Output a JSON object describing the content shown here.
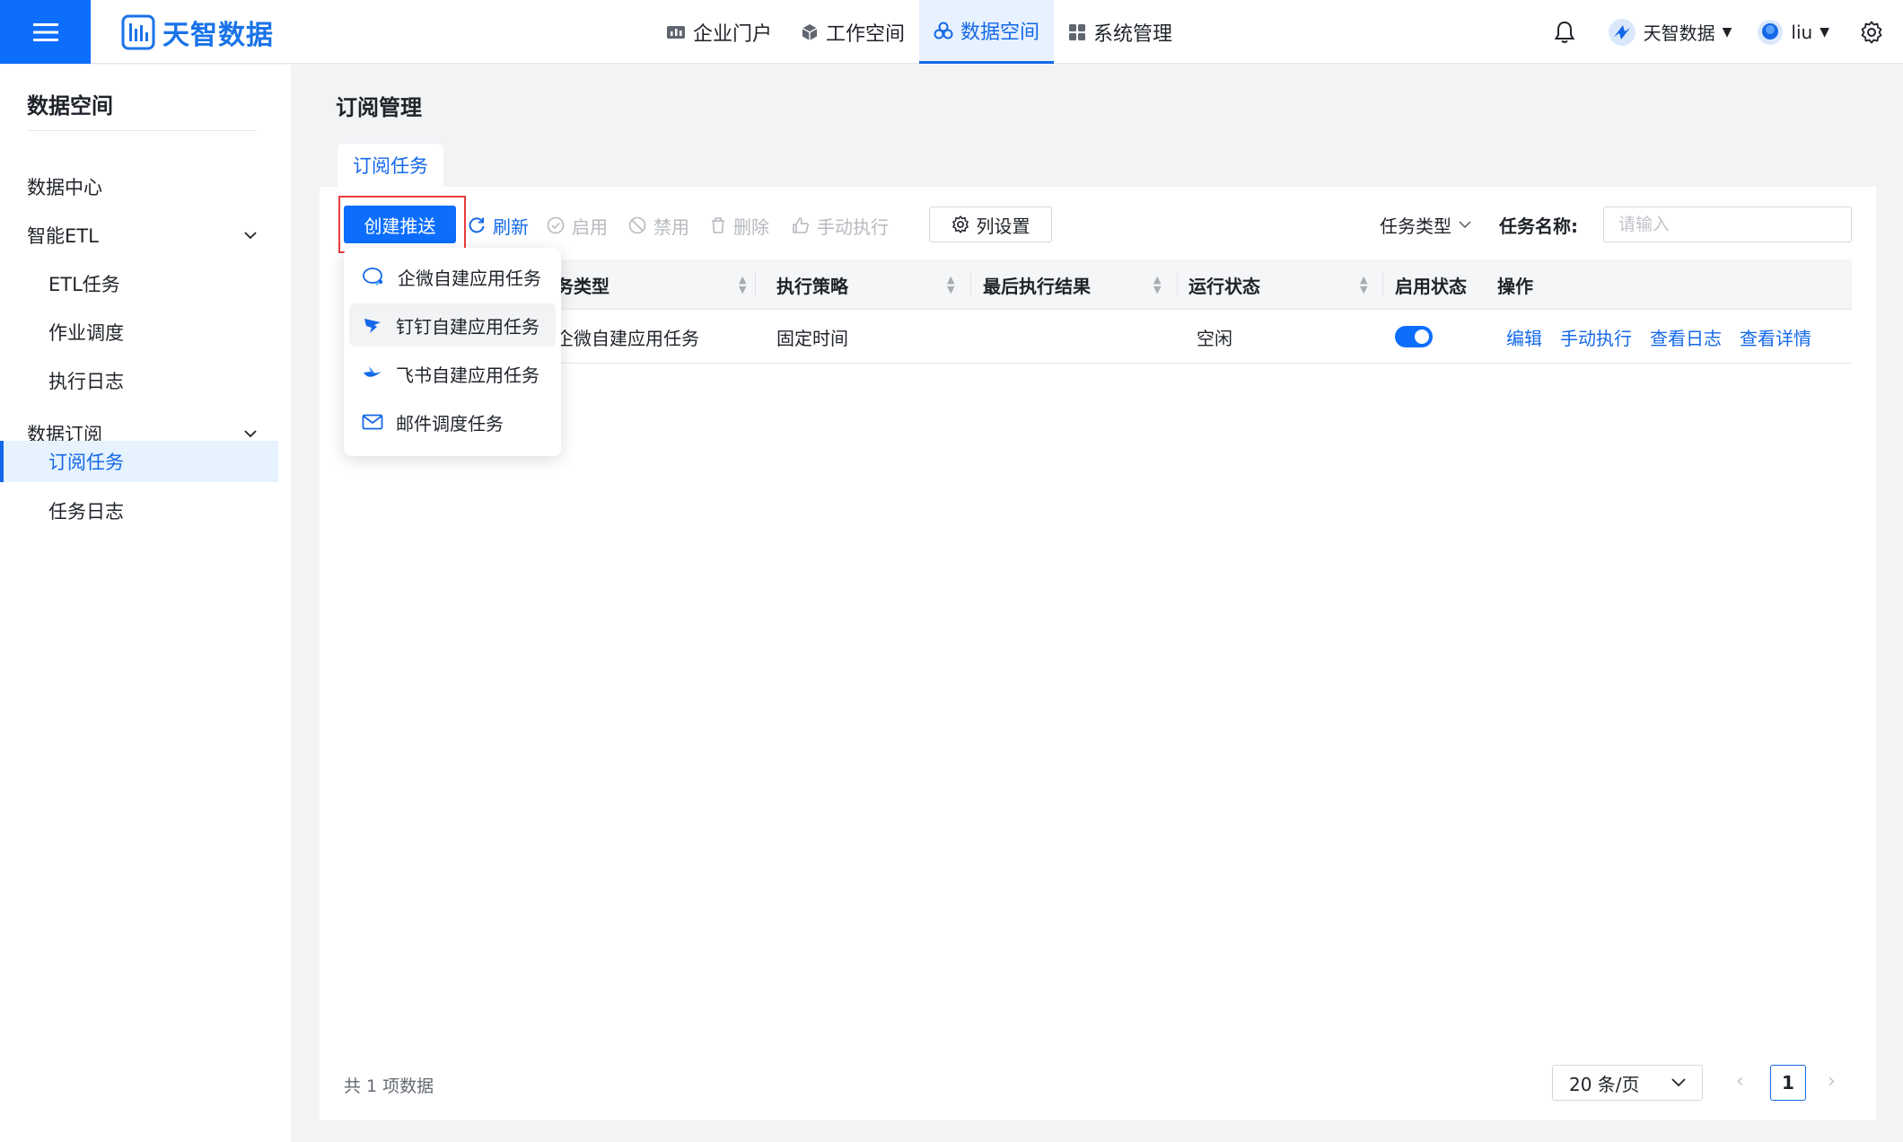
{
  "header": {
    "logo_text": "天智数据",
    "nav": [
      {
        "label": "企业门户",
        "icon": "chart-icon"
      },
      {
        "label": "工作空间",
        "icon": "cube-icon"
      },
      {
        "label": "数据空间",
        "icon": "cluster-icon",
        "active": true
      },
      {
        "label": "系统管理",
        "icon": "grid-icon"
      }
    ],
    "org_label": "天智数据",
    "user_label": "liu"
  },
  "sidebar": {
    "title": "数据空间",
    "items": [
      {
        "label": "数据中心"
      },
      {
        "label": "智能ETL"
      },
      {
        "label": "ETL任务"
      },
      {
        "label": "作业调度"
      },
      {
        "label": "执行日志"
      },
      {
        "label": "数据订阅"
      },
      {
        "label": "订阅任务",
        "active": true
      },
      {
        "label": "任务日志"
      }
    ]
  },
  "main": {
    "page_title": "订阅管理",
    "tab_label": "订阅任务",
    "toolbar": {
      "create_label": "创建推送",
      "refresh_label": "刷新",
      "enable_label": "启用",
      "disable_label": "禁用",
      "delete_label": "删除",
      "manual_label": "手动执行",
      "column_settings_label": "列设置"
    },
    "filters": {
      "task_type_label": "任务类型",
      "task_name_label": "任务名称:",
      "task_name_placeholder": "请输入"
    },
    "table": {
      "columns": [
        "务类型",
        "执行策略",
        "最后执行结果",
        "运行状态",
        "启用状态",
        "操作"
      ],
      "rows": [
        {
          "type": "企微自建应用任务",
          "strategy": "固定时间",
          "last_result": "",
          "run_status": "空闲",
          "enabled": true,
          "actions": [
            "编辑",
            "手动执行",
            "查看日志",
            "查看详情"
          ]
        }
      ]
    },
    "dropdown": {
      "items": [
        {
          "label": "企微自建应用任务",
          "icon": "wecom-icon"
        },
        {
          "label": "钉钉自建应用任务",
          "icon": "dingtalk-icon"
        },
        {
          "label": "飞书自建应用任务",
          "icon": "feishu-icon"
        },
        {
          "label": "邮件调度任务",
          "icon": "mail-icon"
        }
      ]
    },
    "footer": {
      "total_text": "共 1 项数据",
      "page_size": "20 条/页",
      "current_page": "1"
    }
  },
  "colors": {
    "primary": "#0d6efd",
    "link": "#1468e8",
    "highlight_frame": "#ea3d3d"
  }
}
